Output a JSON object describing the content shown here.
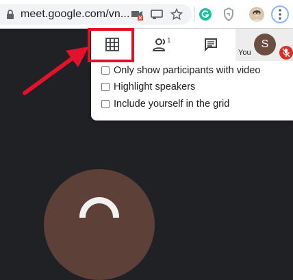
{
  "browser": {
    "url": "meet.google.com/vn...",
    "icons": [
      "lock-icon",
      "camera-blocked-icon",
      "cast-icon",
      "star-icon",
      "grammarly-icon",
      "shield-extension-icon",
      "profile-avatar-icon",
      "kebab-menu-icon"
    ]
  },
  "panel": {
    "tabs": [
      {
        "name": "grid-view-icon"
      },
      {
        "name": "people-icon",
        "badge": "1"
      },
      {
        "name": "chat-icon"
      }
    ],
    "self_tile": {
      "initial": "S",
      "label": "You"
    },
    "options": [
      {
        "label": "Only show participants with video",
        "checked": false
      },
      {
        "label": "Highlight speakers",
        "checked": false
      },
      {
        "label": "Include yourself in the grid",
        "checked": false
      }
    ]
  },
  "colors": {
    "highlight_red": "#e3122a",
    "meet_background": "#202124",
    "avatar_brown": "#5d4037",
    "mic_off_red": "#d93025"
  }
}
